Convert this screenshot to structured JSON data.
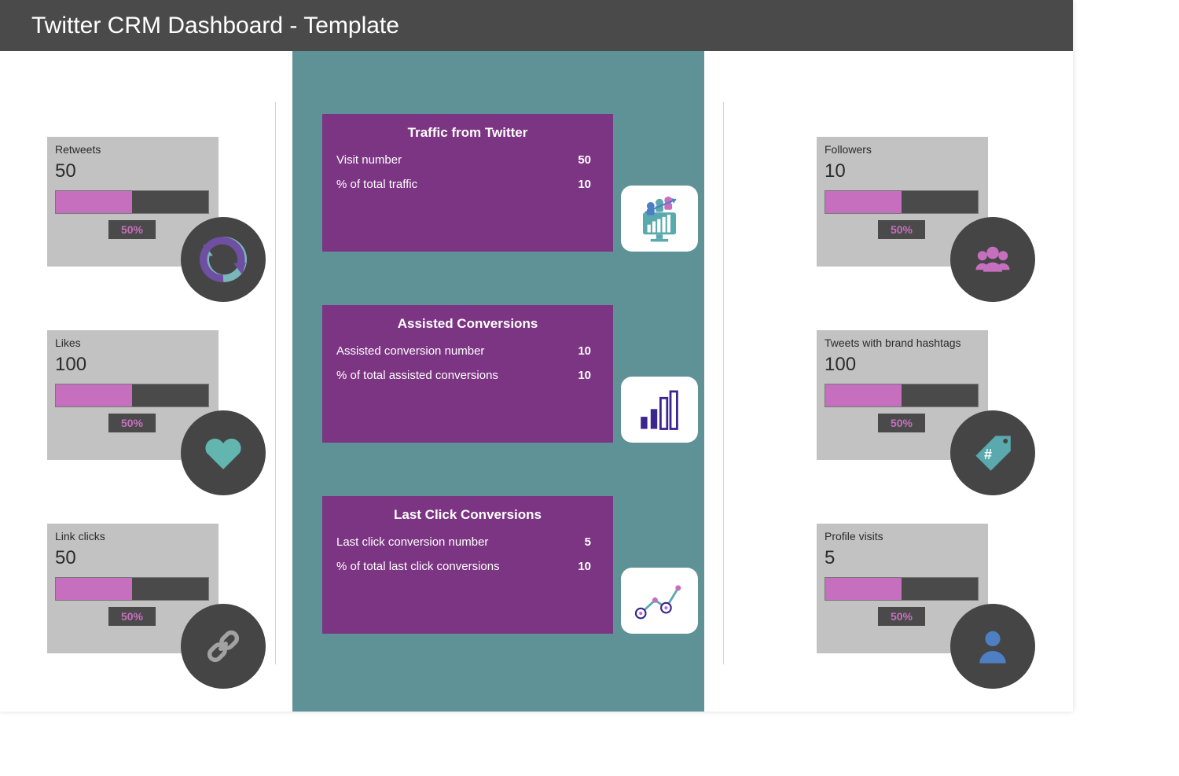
{
  "title": "Twitter CRM Dashboard - Template",
  "kpi_left": [
    {
      "label": "Retweets",
      "value": "50",
      "percent": "50%"
    },
    {
      "label": "Likes",
      "value": "100",
      "percent": "50%"
    },
    {
      "label": "Link clicks",
      "value": "50",
      "percent": "50%"
    }
  ],
  "kpi_right": [
    {
      "label": "Followers",
      "value": "10",
      "percent": "50%"
    },
    {
      "label": "Tweets with brand hashtags",
      "value": "100",
      "percent": "50%"
    },
    {
      "label": "Profile visits",
      "value": "5",
      "percent": "50%"
    }
  ],
  "center_cards": [
    {
      "title": "Traffic from Twitter",
      "rows": [
        {
          "label": "Visit number",
          "value": "50"
        },
        {
          "label": "% of total traffic",
          "value": "10"
        }
      ]
    },
    {
      "title": "Assisted Conversions",
      "rows": [
        {
          "label": "Assisted conversion number",
          "value": "10"
        },
        {
          "label": "% of total assisted conversions",
          "value": "10"
        }
      ]
    },
    {
      "title": "Last Click Conversions",
      "rows": [
        {
          "label": "Last click conversion number",
          "value": "5"
        },
        {
          "label": "% of total last click conversions",
          "value": "10"
        }
      ]
    }
  ]
}
